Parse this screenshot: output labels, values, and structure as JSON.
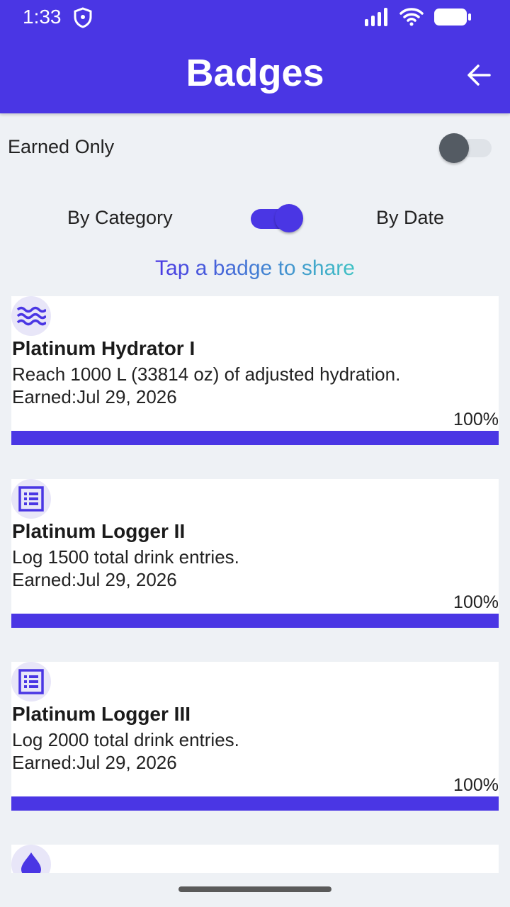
{
  "status_bar": {
    "time": "1:33"
  },
  "header": {
    "title": "Badges"
  },
  "filters": {
    "earned_only_label": "Earned Only",
    "earned_only_on": false,
    "sort_left_label": "By Category",
    "sort_right_label": "By Date"
  },
  "hint": "Tap a badge to share",
  "colors": {
    "primary": "#4a36e4",
    "accent": "#3fc4c4",
    "background": "#eef1f5"
  },
  "badges": [
    {
      "icon": "waves-icon",
      "title": "Platinum Hydrator I",
      "description": "Reach 1000 L (33814 oz) of adjusted hydration.",
      "earned": "Earned:Jul 29, 2026",
      "percent_label": "100%",
      "progress": 1.0
    },
    {
      "icon": "list-icon",
      "title": "Platinum Logger II",
      "description": "Log 1500 total drink entries.",
      "earned": "Earned:Jul 29, 2026",
      "percent_label": "100%",
      "progress": 1.0
    },
    {
      "icon": "list-icon",
      "title": "Platinum Logger III",
      "description": "Log 2000 total drink entries.",
      "earned": "Earned:Jul 29, 2026",
      "percent_label": "100%",
      "progress": 1.0
    },
    {
      "icon": "drop-icon"
    }
  ]
}
